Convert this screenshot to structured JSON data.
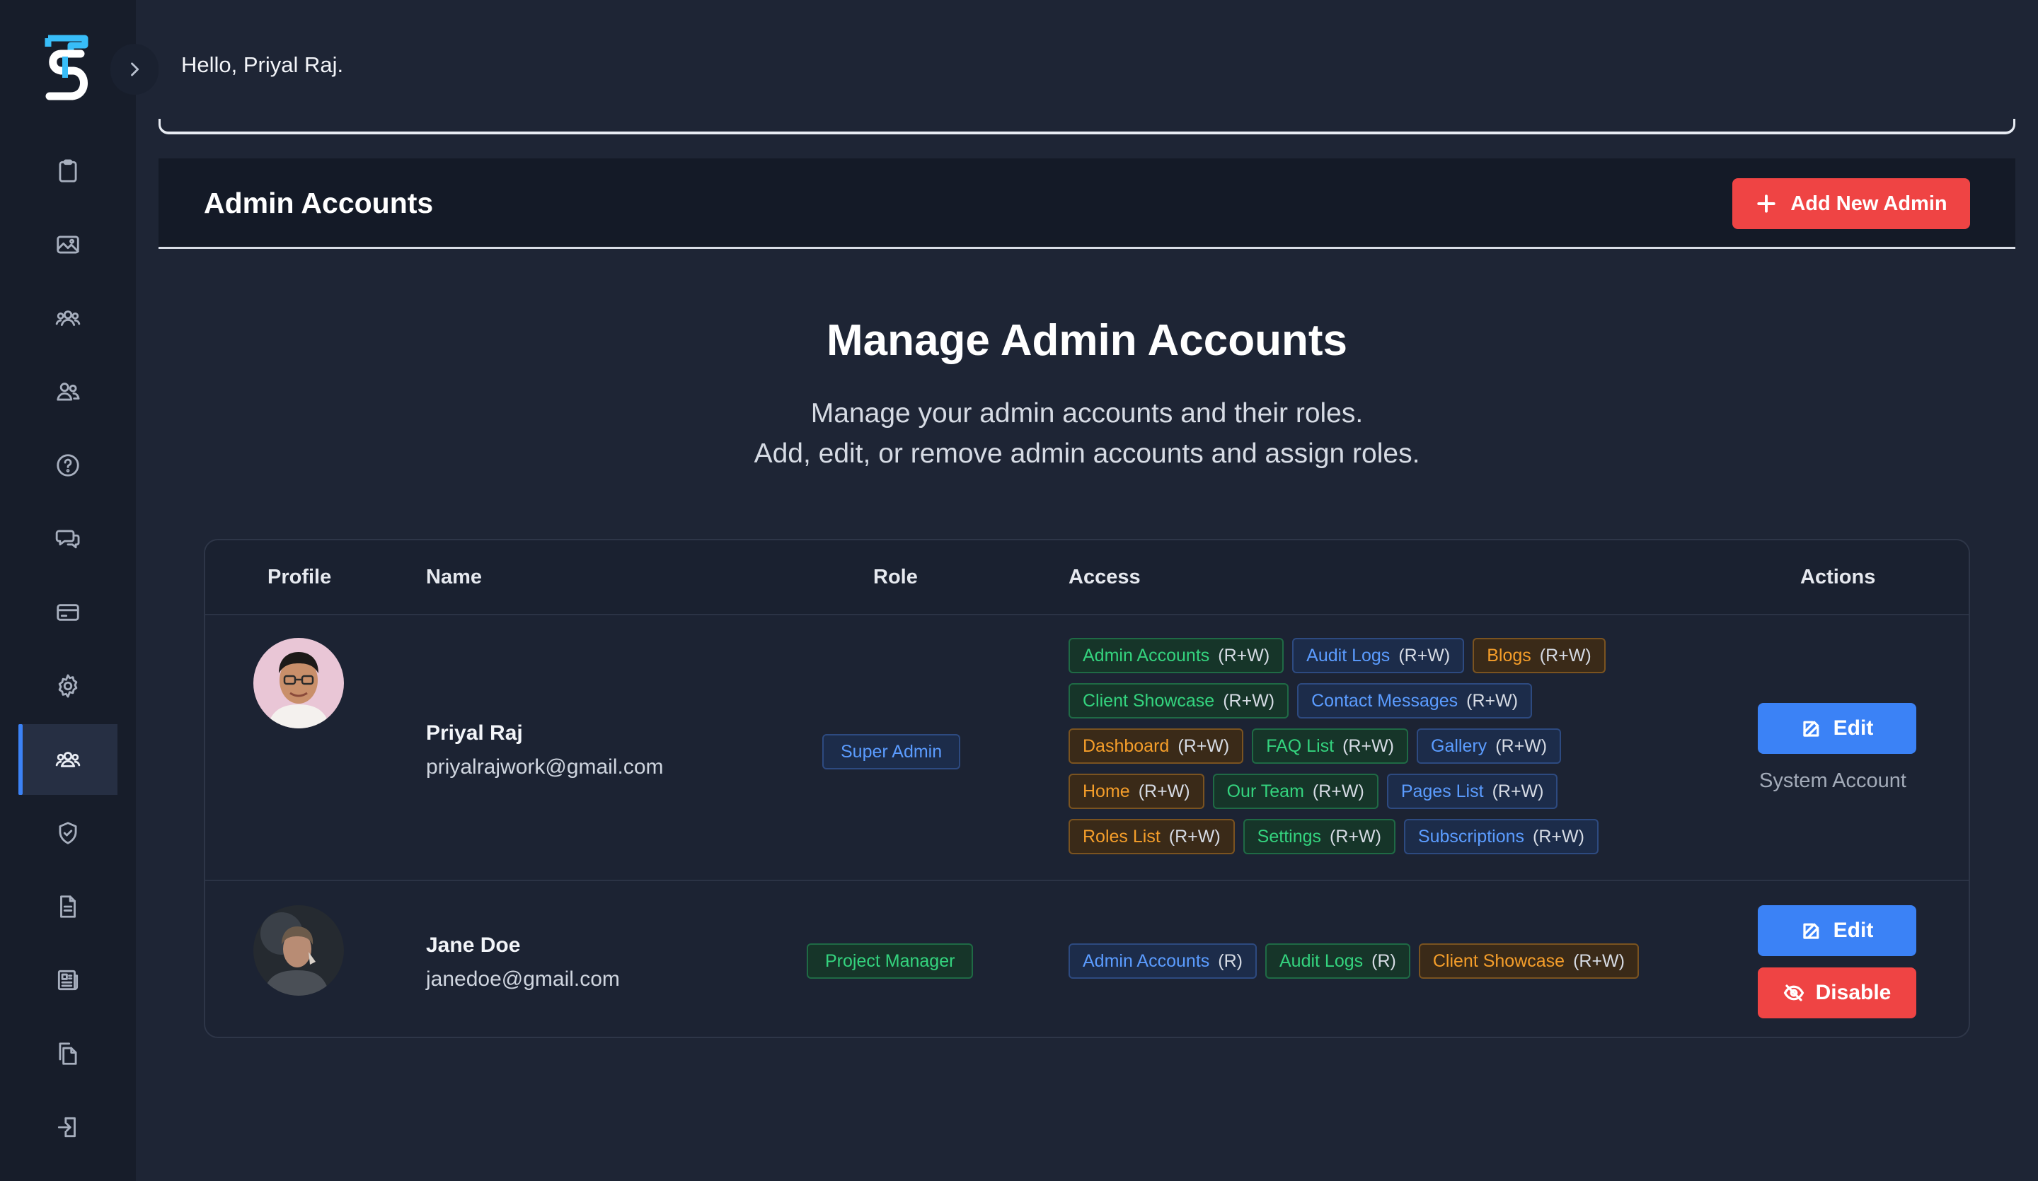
{
  "header": {
    "greeting": "Hello, Priyal Raj."
  },
  "sidebar": {
    "items": [
      {
        "icon": "clipboard-icon"
      },
      {
        "icon": "image-icon"
      },
      {
        "icon": "team-icon"
      },
      {
        "icon": "users-icon"
      },
      {
        "icon": "help-circle-icon"
      },
      {
        "icon": "messages-icon"
      },
      {
        "icon": "credit-card-icon"
      },
      {
        "icon": "settings-icon"
      },
      {
        "icon": "admin-accounts-icon",
        "active": true
      },
      {
        "icon": "shield-check-icon"
      },
      {
        "icon": "document-icon"
      },
      {
        "icon": "newspaper-icon"
      },
      {
        "icon": "pages-icon"
      },
      {
        "icon": "logout-icon"
      }
    ]
  },
  "panel": {
    "title": "Admin Accounts",
    "add_button": "Add New Admin"
  },
  "hero": {
    "title": "Manage Admin Accounts",
    "line1": "Manage your admin accounts and their roles.",
    "line2": "Add, edit, or remove admin accounts and assign roles."
  },
  "table": {
    "headers": {
      "profile": "Profile",
      "name": "Name",
      "role": "Role",
      "access": "Access",
      "actions": "Actions"
    },
    "rows": [
      {
        "name": "Priyal Raj",
        "email": "priyalrajwork@gmail.com",
        "role": "Super Admin",
        "access": [
          {
            "label": "Admin Accounts",
            "perm": "(R+W)",
            "color": "green"
          },
          {
            "label": "Audit Logs",
            "perm": "(R+W)",
            "color": "blue"
          },
          {
            "label": "Blogs",
            "perm": "(R+W)",
            "color": "orange"
          },
          {
            "label": "Client Showcase",
            "perm": "(R+W)",
            "color": "green"
          },
          {
            "label": "Contact Messages",
            "perm": "(R+W)",
            "color": "blue"
          },
          {
            "label": "Dashboard",
            "perm": "(R+W)",
            "color": "orange"
          },
          {
            "label": "FAQ List",
            "perm": "(R+W)",
            "color": "green"
          },
          {
            "label": "Gallery",
            "perm": "(R+W)",
            "color": "blue"
          },
          {
            "label": "Home",
            "perm": "(R+W)",
            "color": "orange"
          },
          {
            "label": "Our Team",
            "perm": "(R+W)",
            "color": "green"
          },
          {
            "label": "Pages List",
            "perm": "(R+W)",
            "color": "blue"
          },
          {
            "label": "Roles List",
            "perm": "(R+W)",
            "color": "orange"
          },
          {
            "label": "Settings",
            "perm": "(R+W)",
            "color": "green"
          },
          {
            "label": "Subscriptions",
            "perm": "(R+W)",
            "color": "blue"
          }
        ],
        "edit_label": "Edit",
        "note": "System Account"
      },
      {
        "name": "Jane Doe",
        "email": "janedoe@gmail.com",
        "role": "Project Manager",
        "access": [
          {
            "label": "Admin Accounts",
            "perm": "(R)",
            "color": "blue"
          },
          {
            "label": "Audit Logs",
            "perm": "(R)",
            "color": "green"
          },
          {
            "label": "Client Showcase",
            "perm": "(R+W)",
            "color": "orange"
          }
        ],
        "edit_label": "Edit",
        "disable_label": "Disable"
      }
    ]
  },
  "colors": {
    "accent_blue": "#3b82f6",
    "danger_red": "#ef4444",
    "tag_green": "#34d37e",
    "tag_blue": "#5b9cff",
    "tag_orange": "#f59e2a"
  }
}
